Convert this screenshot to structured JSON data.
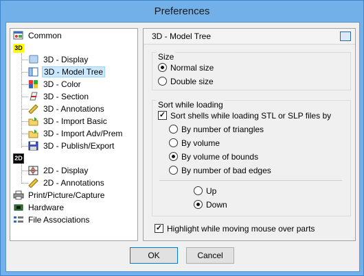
{
  "window": {
    "title": "Preferences"
  },
  "tree": {
    "common": "Common",
    "badge3d": "3D",
    "items3d": [
      {
        "label": "3D - Display"
      },
      {
        "label": "3D - Model Tree",
        "selected": true
      },
      {
        "label": "3D - Color"
      },
      {
        "label": "3D - Section"
      },
      {
        "label": "3D - Annotations"
      },
      {
        "label": "3D - Import Basic"
      },
      {
        "label": "3D - Import Adv/Prem"
      },
      {
        "label": "3D - Publish/Export"
      }
    ],
    "badge2d": "2D",
    "items2d": [
      {
        "label": "2D - Display"
      },
      {
        "label": "2D - Annotations"
      }
    ],
    "print": "Print/Picture/Capture",
    "hardware": "Hardware",
    "fileassoc": "File Associations"
  },
  "panel": {
    "title": "3D - Model Tree",
    "size_group": "Size",
    "normal_size": "Normal size",
    "double_size": "Double size",
    "sort_group": "Sort while loading",
    "sort_shells": "Sort shells while loading STL or SLP files by",
    "by_triangles": "By number of triangles",
    "by_volume": "By volume",
    "by_bounds": "By volume of bounds",
    "by_bad_edges": "By number of bad edges",
    "up": "Up",
    "down": "Down",
    "highlight": "Highlight while moving mouse over parts",
    "state": {
      "size": "Normal size",
      "sort_shells_checked": true,
      "sort_by": "By volume of bounds",
      "direction": "Down",
      "highlight_checked": true
    }
  },
  "buttons": {
    "ok": "OK",
    "cancel": "Cancel"
  }
}
